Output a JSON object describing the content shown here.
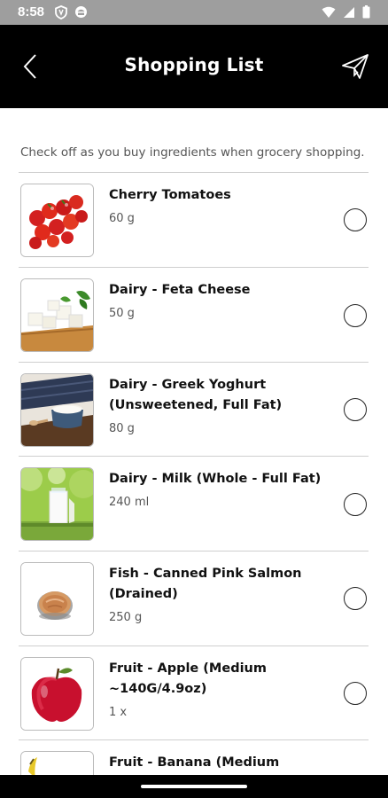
{
  "status_bar": {
    "time": "8:58"
  },
  "app_bar": {
    "title": "Shopping List"
  },
  "instructions": "Check off as you buy ingredients when grocery shopping.",
  "items": [
    {
      "name": "Cherry Tomatoes",
      "quantity": "60 g",
      "checked": false
    },
    {
      "name": "Dairy - Feta Cheese",
      "quantity": "50 g",
      "checked": false
    },
    {
      "name": "Dairy - Greek Yoghurt (Unsweetened, Full Fat)",
      "quantity": "80 g",
      "checked": false
    },
    {
      "name": "Dairy - Milk (Whole - Full Fat)",
      "quantity": "240 ml",
      "checked": false
    },
    {
      "name": "Fish - Canned Pink Salmon (Drained)",
      "quantity": "250 g",
      "checked": false
    },
    {
      "name": "Fruit - Apple (Medium ~140G/4.9oz)",
      "quantity": "1 x",
      "checked": false
    },
    {
      "name": "Fruit - Banana (Medium",
      "quantity": "",
      "checked": false
    }
  ],
  "colors": {
    "app_bar": "#000000",
    "status_bar": "#9e9e9e",
    "text": "#111111",
    "secondary_text": "#555555"
  }
}
